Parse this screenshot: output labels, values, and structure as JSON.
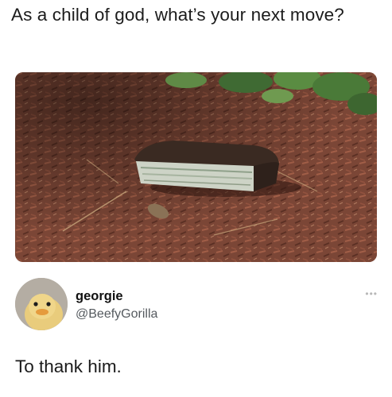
{
  "caption": "As a child of god, what’s your next move?",
  "photo": {
    "icon": "wallet-on-mulch-photo",
    "colors": {
      "mulch": "#7a4535",
      "wallet": "#3a2a22",
      "cash": "#c9cfc2",
      "leaves": "#4e7a3a"
    }
  },
  "tweet": {
    "display_name": "georgie",
    "handle": "@BeefyGorilla",
    "more_label": "•••",
    "text": "To thank him.",
    "avatar_icon": "duckling-avatar"
  }
}
